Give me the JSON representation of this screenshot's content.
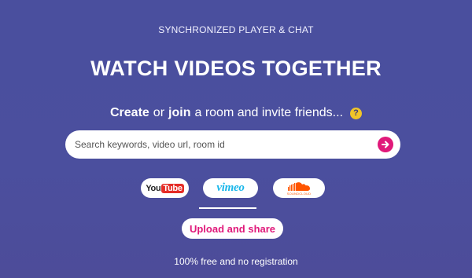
{
  "header": {
    "tagline": "SYNCHRONIZED PLAYER & CHAT",
    "title": "WATCH VIDEOS TOGETHER"
  },
  "intro": {
    "create": "Create",
    "or": "or",
    "join": "join",
    "rest": "a room and invite friends...",
    "help_icon_glyph": "?"
  },
  "search": {
    "placeholder": "Search keywords, video url, room id",
    "value": "",
    "submit_icon": "arrow-right-circle-icon"
  },
  "providers": [
    {
      "name": "YouTube",
      "logo_you": "You",
      "logo_tube": "Tube",
      "selected": false
    },
    {
      "name": "Vimeo",
      "logo": "vimeo",
      "selected": true
    },
    {
      "name": "SoundCloud",
      "logo": "SOUNDCLOUD",
      "selected": false
    }
  ],
  "upload": {
    "label": "Upload and share"
  },
  "footer": {
    "note": "100% free and no registration"
  },
  "colors": {
    "background": "#4b4f9e",
    "accent": "#e0197a",
    "help_badge": "#f0c428",
    "youtube_red": "#e52d27",
    "vimeo_blue": "#1ab7ea",
    "soundcloud_orange": "#ff5500"
  }
}
